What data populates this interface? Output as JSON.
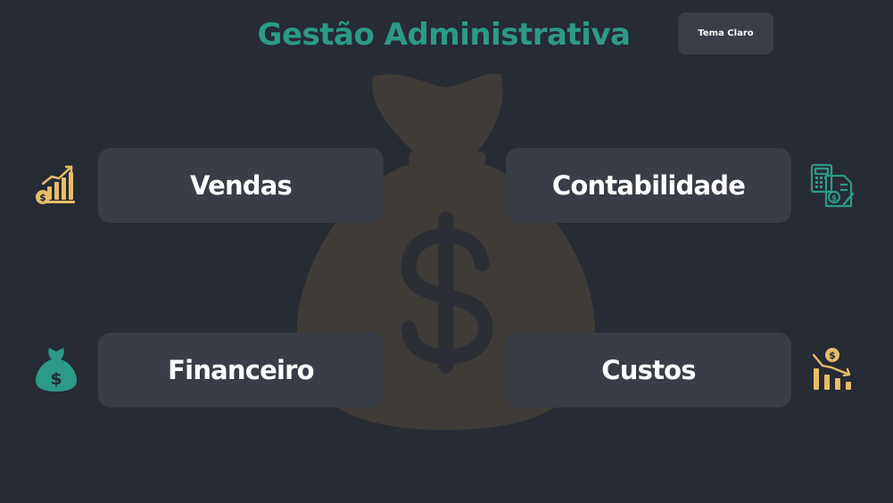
{
  "header": {
    "title": "Gestão Administrativa",
    "theme_button_label": "Tema Claro"
  },
  "cards": {
    "vendas": {
      "label": "Vendas",
      "icon": "sales-growth-icon"
    },
    "contabilidade": {
      "label": "Contabilidade",
      "icon": "accounting-calculator-icon"
    },
    "financeiro": {
      "label": "Financeiro",
      "icon": "money-bag-icon"
    },
    "custos": {
      "label": "Custos",
      "icon": "cost-decrease-icon"
    }
  },
  "background": {
    "icon": "money-bag-icon"
  },
  "colors": {
    "background": "#272b33",
    "card": "#393d46",
    "title_accent": "#2c9a86",
    "gold_icon": "#e6bd6a",
    "teal_icon": "#2c9a86",
    "watermark": "#3f3c38"
  }
}
